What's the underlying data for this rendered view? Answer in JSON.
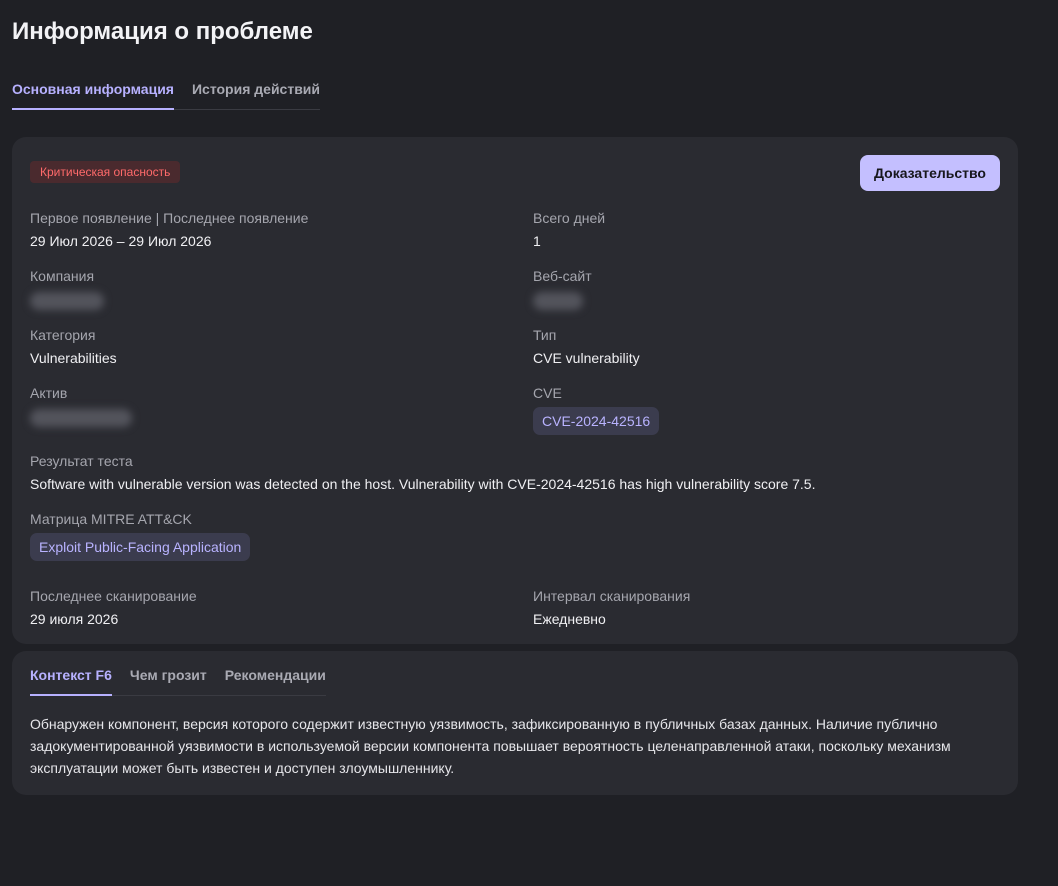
{
  "page": {
    "title": "Информация о проблеме"
  },
  "tabs": [
    {
      "label": "Основная информация",
      "active": true
    },
    {
      "label": "История действий",
      "active": false
    }
  ],
  "issue": {
    "severity_badge": "Критическая опасность",
    "evidence_button": "Доказательство",
    "first_last_seen": {
      "label": "Первое появление | Последнее появление",
      "value": "29 Июл 2026 – 29 Июл 2026"
    },
    "total_days": {
      "label": "Всего дней",
      "value": "1"
    },
    "company": {
      "label": "Компания"
    },
    "website": {
      "label": "Веб-сайт"
    },
    "category": {
      "label": "Категория",
      "value": "Vulnerabilities"
    },
    "type": {
      "label": "Тип",
      "value": "CVE vulnerability"
    },
    "asset": {
      "label": "Актив"
    },
    "cve": {
      "label": "CVE",
      "value": "CVE-2024-42516"
    },
    "test_result": {
      "label": "Результат теста",
      "value": "Software with vulnerable version was detected on the host. Vulnerability with CVE-2024-42516 has high vulnerability score 7.5."
    },
    "mitre": {
      "label": "Матрица MITRE ATT&CK",
      "value": "Exploit Public-Facing Application"
    },
    "last_scan": {
      "label": "Последнее сканирование",
      "value": "29 июля 2026"
    },
    "scan_interval": {
      "label": "Интервал сканирования",
      "value": "Ежедневно"
    }
  },
  "context": {
    "tabs": [
      {
        "label": "Контекст F6",
        "active": true
      },
      {
        "label": "Чем грозит",
        "active": false
      },
      {
        "label": "Рекомендации",
        "active": false
      }
    ],
    "text": "Обнаружен компонент, версия которого содержит известную уязвимость, зафиксированную в публичных базах данных. Наличие публично задокументированной уязвимости в используемой версии компонента повышает вероятность целенаправленной атаки, поскольку механизм эксплуатации может быть известен и доступен злоумышленнику."
  },
  "colors": {
    "background": "#1f2025",
    "card": "#2a2b31",
    "accent": "#b7b1ff",
    "button": "#c4bfff",
    "critical": "#ff6a6a"
  }
}
